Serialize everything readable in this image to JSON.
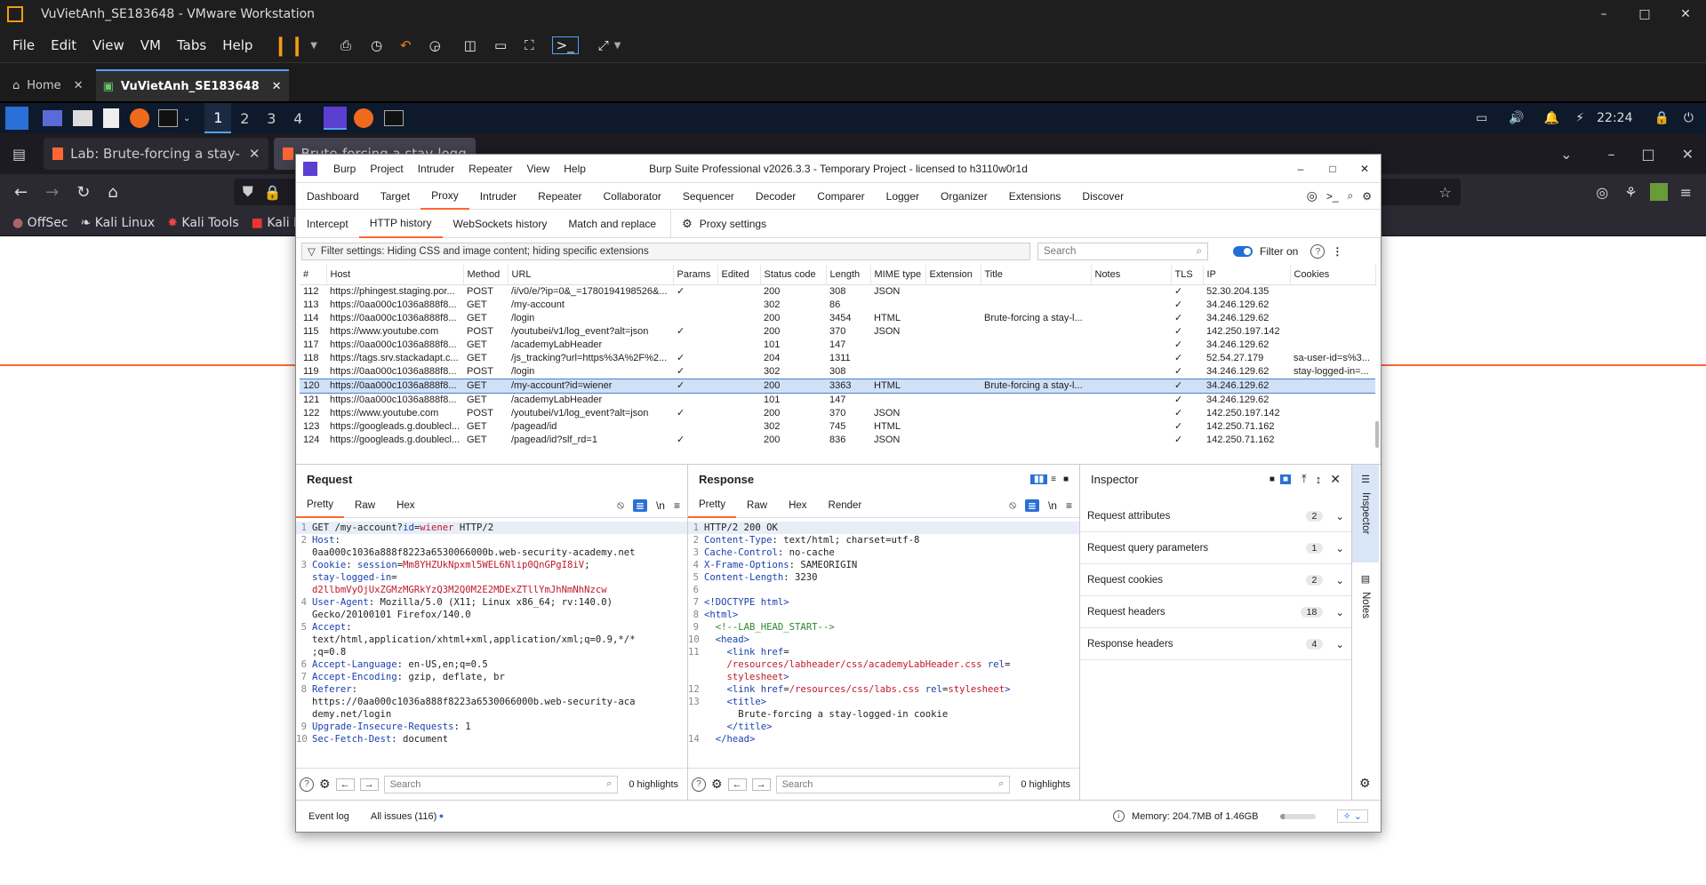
{
  "vmware": {
    "title": "VuVietAnh_SE183648 - VMware Workstation",
    "menu": [
      "File",
      "Edit",
      "View",
      "VM",
      "Tabs",
      "Help"
    ],
    "tabs": [
      {
        "label": "Home"
      },
      {
        "label": "VuVietAnh_SE183648"
      }
    ]
  },
  "kali": {
    "workspaces": [
      "1",
      "2",
      "3",
      "4"
    ],
    "clock": "22:24"
  },
  "firefox": {
    "tabs": [
      "Lab: Brute-forcing a stay-",
      "Brute-forcing a stay-logg"
    ],
    "bookmarks": [
      "OffSec",
      "Kali Linux",
      "Kali Tools",
      "Kali D"
    ]
  },
  "burp": {
    "title": "Burp Suite Professional v2026.3.3 - Temporary Project - licensed to h3110w0r1d",
    "menu": [
      "Burp",
      "Project",
      "Intruder",
      "Repeater",
      "View",
      "Help"
    ],
    "main_tabs": [
      "Dashboard",
      "Target",
      "Proxy",
      "Intruder",
      "Repeater",
      "Collaborator",
      "Sequencer",
      "Decoder",
      "Comparer",
      "Logger",
      "Organizer",
      "Extensions",
      "Discover"
    ],
    "sub_tabs": [
      "Intercept",
      "HTTP history",
      "WebSockets history",
      "Match and replace"
    ],
    "proxy_settings": "Proxy settings",
    "filter_text": "Filter settings: Hiding CSS and image content; hiding specific extensions",
    "search_placeholder": "Search",
    "filter_on": "Filter on",
    "columns": [
      "#",
      "Host",
      "Method",
      "URL",
      "Params",
      "Edited",
      "Status code",
      "Length",
      "MIME type",
      "Extension",
      "Title",
      "Notes",
      "TLS",
      "IP",
      "Cookies"
    ],
    "rows": [
      {
        "id": "112",
        "host": "https://phingest.staging.por...",
        "method": "POST",
        "url": "/i/v0/e/?ip=0&_=1780194198526&...",
        "params": true,
        "status": "200",
        "length": "308",
        "mime": "JSON",
        "title": "",
        "tls": true,
        "ip": "52.30.204.135",
        "cookies": ""
      },
      {
        "id": "113",
        "host": "https://0aa000c1036a888f8...",
        "method": "GET",
        "url": "/my-account",
        "params": false,
        "status": "302",
        "length": "86",
        "mime": "",
        "title": "",
        "tls": true,
        "ip": "34.246.129.62",
        "cookies": ""
      },
      {
        "id": "114",
        "host": "https://0aa000c1036a888f8...",
        "method": "GET",
        "url": "/login",
        "params": false,
        "status": "200",
        "length": "3454",
        "mime": "HTML",
        "title": "Brute-forcing a stay-l...",
        "tls": true,
        "ip": "34.246.129.62",
        "cookies": ""
      },
      {
        "id": "115",
        "host": "https://www.youtube.com",
        "method": "POST",
        "url": "/youtubei/v1/log_event?alt=json",
        "params": true,
        "status": "200",
        "length": "370",
        "mime": "JSON",
        "title": "",
        "tls": true,
        "ip": "142.250.197.142",
        "cookies": ""
      },
      {
        "id": "117",
        "host": "https://0aa000c1036a888f8...",
        "method": "GET",
        "url": "/academyLabHeader",
        "params": false,
        "status": "101",
        "length": "147",
        "mime": "",
        "title": "",
        "tls": true,
        "ip": "34.246.129.62",
        "cookies": ""
      },
      {
        "id": "118",
        "host": "https://tags.srv.stackadapt.c...",
        "method": "GET",
        "url": "/js_tracking?url=https%3A%2F%2...",
        "params": true,
        "status": "204",
        "length": "1311",
        "mime": "",
        "title": "",
        "tls": true,
        "ip": "52.54.27.179",
        "cookies": "sa-user-id=s%3..."
      },
      {
        "id": "119",
        "host": "https://0aa000c1036a888f8...",
        "method": "POST",
        "url": "/login",
        "params": true,
        "status": "302",
        "length": "308",
        "mime": "",
        "title": "",
        "tls": true,
        "ip": "34.246.129.62",
        "cookies": "stay-logged-in=..."
      },
      {
        "id": "120",
        "host": "https://0aa000c1036a888f8...",
        "method": "GET",
        "url": "/my-account?id=wiener",
        "params": true,
        "status": "200",
        "length": "3363",
        "mime": "HTML",
        "title": "Brute-forcing a stay-l...",
        "tls": true,
        "ip": "34.246.129.62",
        "cookies": "",
        "selected": true
      },
      {
        "id": "121",
        "host": "https://0aa000c1036a888f8...",
        "method": "GET",
        "url": "/academyLabHeader",
        "params": false,
        "status": "101",
        "length": "147",
        "mime": "",
        "title": "",
        "tls": true,
        "ip": "34.246.129.62",
        "cookies": ""
      },
      {
        "id": "122",
        "host": "https://www.youtube.com",
        "method": "POST",
        "url": "/youtubei/v1/log_event?alt=json",
        "params": true,
        "status": "200",
        "length": "370",
        "mime": "JSON",
        "title": "",
        "tls": true,
        "ip": "142.250.197.142",
        "cookies": ""
      },
      {
        "id": "123",
        "host": "https://googleads.g.doublecl...",
        "method": "GET",
        "url": "/pagead/id",
        "params": false,
        "status": "302",
        "length": "745",
        "mime": "HTML",
        "title": "",
        "tls": true,
        "ip": "142.250.71.162",
        "cookies": ""
      },
      {
        "id": "124",
        "host": "https://googleads.g.doublecl...",
        "method": "GET",
        "url": "/pagead/id?slf_rd=1",
        "params": true,
        "status": "200",
        "length": "836",
        "mime": "JSON",
        "title": "",
        "tls": true,
        "ip": "142.250.71.162",
        "cookies": ""
      }
    ],
    "request": {
      "title": "Request",
      "tabs": [
        "Pretty",
        "Raw",
        "Hex"
      ],
      "search": "Search",
      "highlights": "0 highlights"
    },
    "response": {
      "title": "Response",
      "tabs": [
        "Pretty",
        "Raw",
        "Hex",
        "Render"
      ],
      "search": "Search",
      "highlights": "0 highlights"
    },
    "inspector": {
      "title": "Inspector",
      "rows": [
        {
          "label": "Request attributes",
          "count": "2"
        },
        {
          "label": "Request query parameters",
          "count": "1"
        },
        {
          "label": "Request cookies",
          "count": "2"
        },
        {
          "label": "Request headers",
          "count": "18"
        },
        {
          "label": "Response headers",
          "count": "4"
        }
      ],
      "side": [
        "Inspector",
        "Notes"
      ]
    },
    "status": {
      "event_log": "Event log",
      "issues": "All issues (116)",
      "memory": "Memory: 204.7MB of 1.46GB",
      "memory_fraction": 0.14
    }
  }
}
